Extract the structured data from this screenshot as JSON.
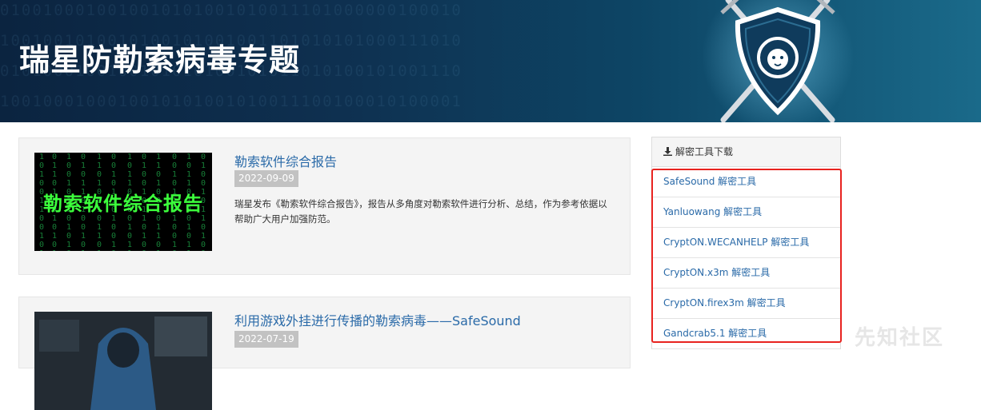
{
  "banner": {
    "title": "瑞星防勒索病毒专题",
    "binary_lines": [
      "0100100010010010101001010011101000000100010",
      "1001001010010100101001001101010101000111010",
      "0101000100100101010100101011010100101001110",
      "1001000100010010101001010011100100010100001"
    ]
  },
  "articles": [
    {
      "title": "勒索软件综合报告",
      "date": "2022-09-09",
      "summary": "瑞星发布《勒索软件综合报告》，报告从多角度对勒索软件进行分析、总结，作为参考依据以帮助广大用户加强防范。",
      "thumb_text": "勒索软件综合报告"
    },
    {
      "title": "利用游戏外挂进行传播的勒索病毒——SafeSound",
      "date": "2022-07-19"
    }
  ],
  "sidebar": {
    "heading": "解密工具下载",
    "download_icon": "download-icon",
    "items": [
      {
        "label": "SafeSound 解密工具"
      },
      {
        "label": "Yanluowang 解密工具"
      },
      {
        "label": "CryptON.WECANHELP 解密工具"
      },
      {
        "label": "CryptON.x3m 解密工具"
      },
      {
        "label": "CryptON.firex3m 解密工具"
      },
      {
        "label": "Gandcrab5.1 解密工具"
      }
    ]
  },
  "watermark": "先知社区",
  "colors": {
    "link": "#2a6aa8",
    "highlight": "#e8231f",
    "date_badge": "#c2c2c2"
  }
}
